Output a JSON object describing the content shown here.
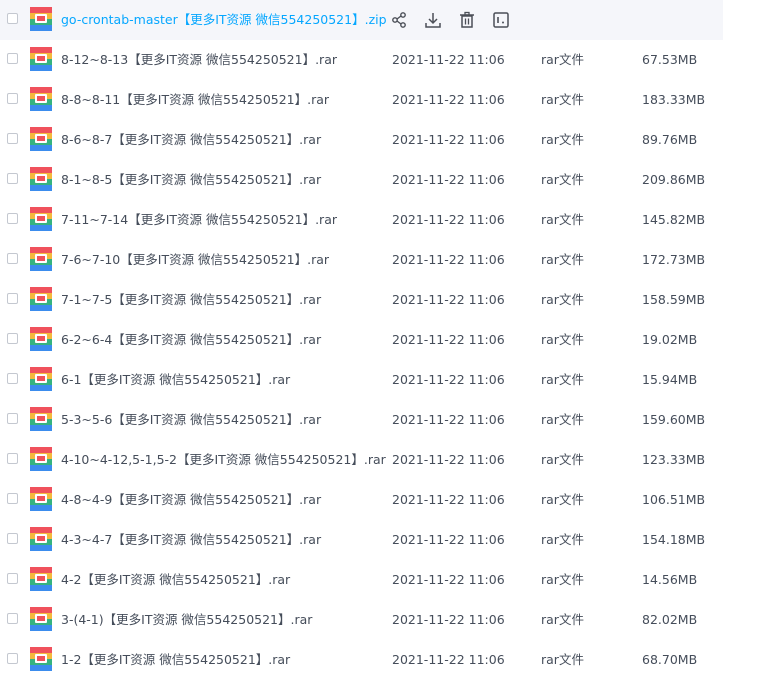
{
  "colors": {
    "accent": "#06a7ff",
    "hover_row": "#f5f6fa"
  },
  "hover_row": {
    "name": "go-crontab-master【更多IT资源 微信554250521】.zip",
    "actions": [
      "share-icon",
      "download-icon",
      "delete-icon",
      "more-icon"
    ]
  },
  "files": [
    {
      "name": "8-12~8-13【更多IT资源 微信554250521】.rar",
      "date": "2021-11-22 11:06",
      "type": "rar文件",
      "size": "67.53MB"
    },
    {
      "name": "8-8~8-11【更多IT资源 微信554250521】.rar",
      "date": "2021-11-22 11:06",
      "type": "rar文件",
      "size": "183.33MB"
    },
    {
      "name": "8-6~8-7【更多IT资源 微信554250521】.rar",
      "date": "2021-11-22 11:06",
      "type": "rar文件",
      "size": "89.76MB"
    },
    {
      "name": "8-1~8-5【更多IT资源 微信554250521】.rar",
      "date": "2021-11-22 11:06",
      "type": "rar文件",
      "size": "209.86MB"
    },
    {
      "name": "7-11~7-14【更多IT资源 微信554250521】.rar",
      "date": "2021-11-22 11:06",
      "type": "rar文件",
      "size": "145.82MB"
    },
    {
      "name": "7-6~7-10【更多IT资源 微信554250521】.rar",
      "date": "2021-11-22 11:06",
      "type": "rar文件",
      "size": "172.73MB"
    },
    {
      "name": "7-1~7-5【更多IT资源 微信554250521】.rar",
      "date": "2021-11-22 11:06",
      "type": "rar文件",
      "size": "158.59MB"
    },
    {
      "name": "6-2~6-4【更多IT资源 微信554250521】.rar",
      "date": "2021-11-22 11:06",
      "type": "rar文件",
      "size": "19.02MB"
    },
    {
      "name": "6-1【更多IT资源 微信554250521】.rar",
      "date": "2021-11-22 11:06",
      "type": "rar文件",
      "size": "15.94MB"
    },
    {
      "name": "5-3~5-6【更多IT资源 微信554250521】.rar",
      "date": "2021-11-22 11:06",
      "type": "rar文件",
      "size": "159.60MB"
    },
    {
      "name": "4-10~4-12,5-1,5-2【更多IT资源 微信554250521】.rar",
      "date": "2021-11-22 11:06",
      "type": "rar文件",
      "size": "123.33MB"
    },
    {
      "name": "4-8~4-9【更多IT资源 微信554250521】.rar",
      "date": "2021-11-22 11:06",
      "type": "rar文件",
      "size": "106.51MB"
    },
    {
      "name": "4-3~4-7【更多IT资源 微信554250521】.rar",
      "date": "2021-11-22 11:06",
      "type": "rar文件",
      "size": "154.18MB"
    },
    {
      "name": "4-2【更多IT资源 微信554250521】.rar",
      "date": "2021-11-22 11:06",
      "type": "rar文件",
      "size": "14.56MB"
    },
    {
      "name": "3-(4-1)【更多IT资源 微信554250521】.rar",
      "date": "2021-11-22 11:06",
      "type": "rar文件",
      "size": "82.02MB"
    },
    {
      "name": "1-2【更多IT资源 微信554250521】.rar",
      "date": "2021-11-22 11:06",
      "type": "rar文件",
      "size": "68.70MB"
    }
  ]
}
